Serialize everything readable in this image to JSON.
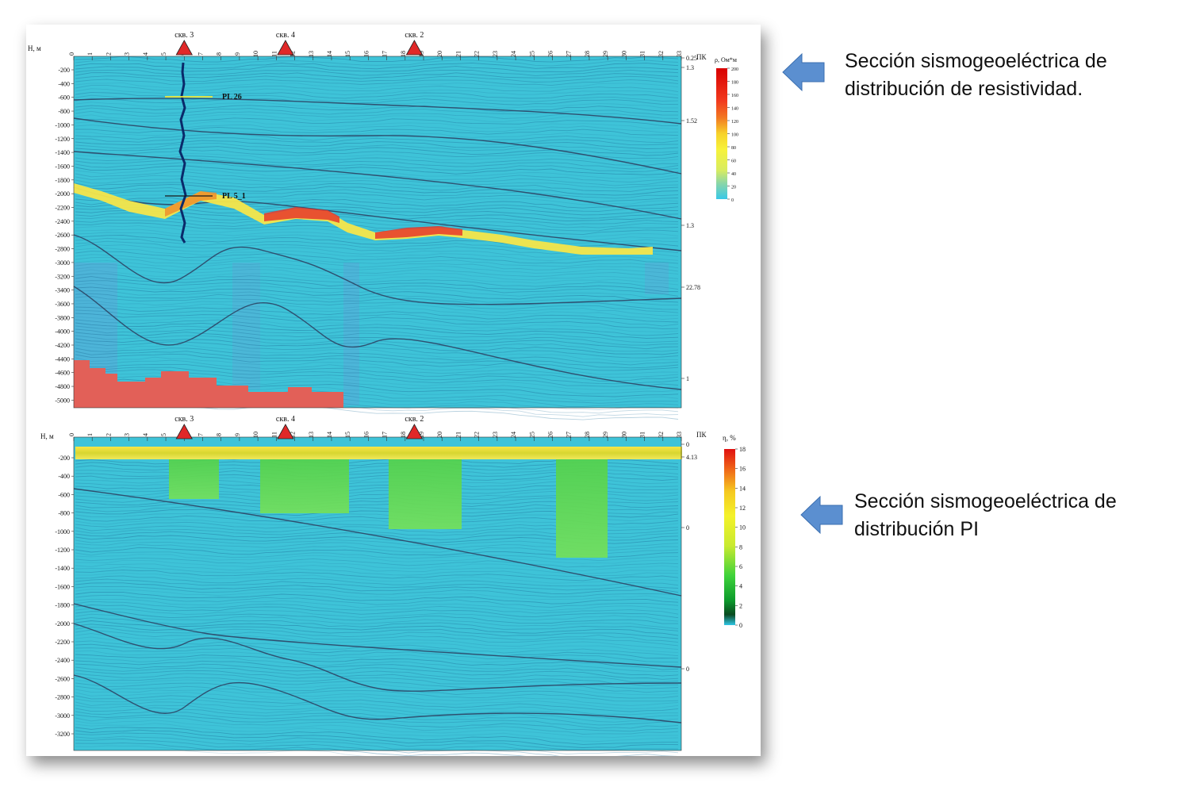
{
  "captions": {
    "top_line1": "Sección sismogeoeléctrica de",
    "top_line2": "distribución de resistividad.",
    "bottom_line1": "Sección sismogeoeléctrica de",
    "bottom_line2": "distribución PI"
  },
  "colors": {
    "seismic_background": "#3ec3d8",
    "high_resistivity": "#e05a50",
    "well_marker": "#e02828",
    "arrow": "#5b8fd0"
  },
  "top_section": {
    "depth_axis_label": "H, м",
    "pk_label": "ПК",
    "scale_title": "ρ, Ом*м",
    "scale_ticks": [
      "200",
      "180",
      "160",
      "140",
      "120",
      "100",
      "80",
      "60",
      "40",
      "20",
      "0"
    ],
    "depth_ticks": [
      "-200",
      "-400",
      "-600",
      "-800",
      "-1000",
      "-1200",
      "-1400",
      "-1600",
      "-1800",
      "-2000",
      "-2200",
      "-2400",
      "-2600",
      "-2800",
      "-3000",
      "-3200",
      "-3400",
      "-3600",
      "-3800",
      "-4000",
      "-4200",
      "-4400",
      "-4600",
      "-4800",
      "-5000"
    ],
    "pk_ticks": [
      "0",
      "1",
      "2",
      "3",
      "4",
      "5",
      "6",
      "7",
      "8",
      "9",
      "10",
      "11",
      "12",
      "13",
      "14",
      "15",
      "16",
      "17",
      "18",
      "19",
      "20",
      "21",
      "22",
      "23",
      "24",
      "25",
      "26",
      "27",
      "28",
      "29",
      "30",
      "31",
      "32",
      "33"
    ],
    "wells": [
      {
        "label": "скв. 3",
        "pk": 6
      },
      {
        "label": "скв. 4",
        "pk": 11.5
      },
      {
        "label": "скв. 2",
        "pk": 18.5
      }
    ],
    "horizon_labels": [
      "PL 26",
      "PL 5_1"
    ],
    "right_values": [
      "0.25",
      "1.3",
      "1.52",
      "1.3",
      "22.78",
      "1"
    ]
  },
  "bottom_section": {
    "depth_axis_label": "H, м",
    "pk_label": "ПК",
    "scale_title": "η, %",
    "scale_ticks": [
      "18",
      "16",
      "14",
      "12",
      "10",
      "8",
      "6",
      "4",
      "2",
      "0"
    ],
    "depth_ticks": [
      "-200",
      "-400",
      "-600",
      "-800",
      "-1000",
      "-1200",
      "-1400",
      "-1600",
      "-1800",
      "-2000",
      "-2200",
      "-2400",
      "-2600",
      "-2800",
      "-3000",
      "-3200"
    ],
    "pk_ticks": [
      "0",
      "1",
      "2",
      "3",
      "4",
      "5",
      "6",
      "7",
      "8",
      "9",
      "10",
      "11",
      "12",
      "13",
      "14",
      "15",
      "16",
      "17",
      "18",
      "19",
      "20",
      "21",
      "22",
      "23",
      "24",
      "25",
      "26",
      "27",
      "28",
      "29",
      "30",
      "31",
      "32",
      "33"
    ],
    "wells": [
      {
        "label": "скв. 3",
        "pk": 6
      },
      {
        "label": "скв. 4",
        "pk": 11.5
      },
      {
        "label": "скв. 2",
        "pk": 18.5
      }
    ],
    "right_values": [
      "0",
      "4.13",
      "0",
      "0"
    ]
  }
}
